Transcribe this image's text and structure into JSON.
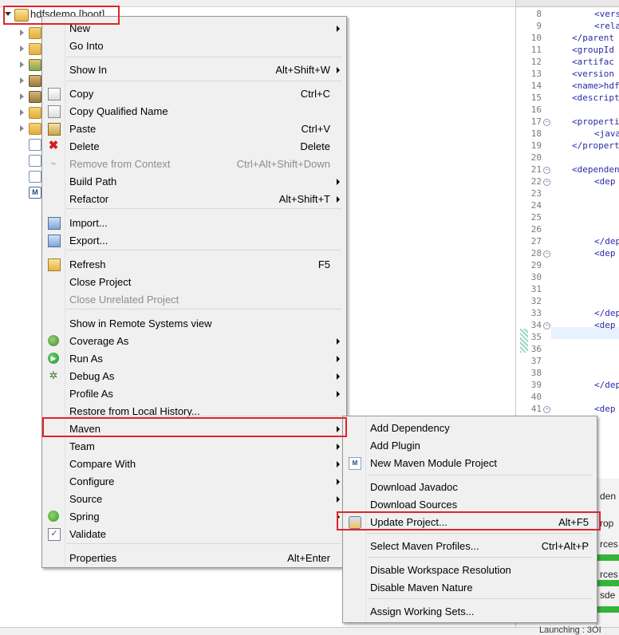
{
  "explorer": {
    "root_label": "hdfsdemo [boot]",
    "tree_icons": [
      "folder-icon",
      "folder-icon",
      "jar-icon",
      "library-icon",
      "library-icon",
      "folder-icon",
      "folder-icon",
      "file-icon",
      "file-icon",
      "file-icon",
      "maven-file-icon"
    ]
  },
  "editor": {
    "line_numbers": [
      "8",
      "9",
      "10",
      "11",
      "12",
      "13",
      "14",
      "15",
      "16",
      "17",
      "18",
      "19",
      "20",
      "21",
      "22",
      "23",
      "24",
      "25",
      "26",
      "27",
      "28",
      "29",
      "30",
      "31",
      "32",
      "33",
      "34",
      "35",
      "36",
      "37",
      "38",
      "39",
      "40",
      "41"
    ],
    "code_lines": [
      "<vers",
      "<rela",
      "</parent",
      "<groupId",
      "<artifac",
      "<version",
      "<name>hdf",
      "<descript",
      "",
      "<properti",
      "<java",
      "</propert",
      "",
      "<dependen",
      "<dep",
      "",
      "",
      "",
      "",
      "</dep",
      "<dep",
      "",
      "",
      "",
      "",
      "</dep",
      "<dep",
      "",
      "",
      "",
      "",
      "</dep",
      "",
      "<dep"
    ],
    "console_texts": [
      "den",
      "rop",
      "rces",
      "rces",
      "sde"
    ],
    "status_text": "Launching : 3OI"
  },
  "context_menu": {
    "items": [
      {
        "label": "New",
        "shortcut": "",
        "submenu": true,
        "icon": "",
        "disabled": false
      },
      {
        "label": "Go Into",
        "shortcut": "",
        "submenu": false,
        "icon": "",
        "disabled": false
      },
      {
        "label": "Show In",
        "shortcut": "Alt+Shift+W",
        "submenu": true,
        "icon": "",
        "disabled": false
      },
      {
        "label": "Copy",
        "shortcut": "Ctrl+C",
        "submenu": false,
        "icon": "copy-icon",
        "disabled": false
      },
      {
        "label": "Copy Qualified Name",
        "shortcut": "",
        "submenu": false,
        "icon": "copy-qualified-icon",
        "disabled": false
      },
      {
        "label": "Paste",
        "shortcut": "Ctrl+V",
        "submenu": false,
        "icon": "paste-icon",
        "disabled": false
      },
      {
        "label": "Delete",
        "shortcut": "Delete",
        "submenu": false,
        "icon": "delete-icon",
        "disabled": false
      },
      {
        "label": "Remove from Context",
        "shortcut": "Ctrl+Alt+Shift+Down",
        "submenu": false,
        "icon": "remove-context-icon",
        "disabled": true
      },
      {
        "label": "Build Path",
        "shortcut": "",
        "submenu": true,
        "icon": "",
        "disabled": false
      },
      {
        "label": "Refactor",
        "shortcut": "Alt+Shift+T",
        "submenu": true,
        "icon": "",
        "disabled": false
      },
      {
        "label": "Import...",
        "shortcut": "",
        "submenu": false,
        "icon": "import-icon",
        "disabled": false
      },
      {
        "label": "Export...",
        "shortcut": "",
        "submenu": false,
        "icon": "export-icon",
        "disabled": false
      },
      {
        "label": "Refresh",
        "shortcut": "F5",
        "submenu": false,
        "icon": "refresh-icon",
        "disabled": false
      },
      {
        "label": "Close Project",
        "shortcut": "",
        "submenu": false,
        "icon": "",
        "disabled": false
      },
      {
        "label": "Close Unrelated Project",
        "shortcut": "",
        "submenu": false,
        "icon": "",
        "disabled": true
      },
      {
        "label": "Show in Remote Systems view",
        "shortcut": "",
        "submenu": false,
        "icon": "",
        "disabled": false
      },
      {
        "label": "Coverage As",
        "shortcut": "",
        "submenu": true,
        "icon": "coverage-icon",
        "disabled": false
      },
      {
        "label": "Run As",
        "shortcut": "",
        "submenu": true,
        "icon": "run-icon",
        "disabled": false
      },
      {
        "label": "Debug As",
        "shortcut": "",
        "submenu": true,
        "icon": "debug-icon",
        "disabled": false
      },
      {
        "label": "Profile As",
        "shortcut": "",
        "submenu": true,
        "icon": "",
        "disabled": false
      },
      {
        "label": "Restore from Local History...",
        "shortcut": "",
        "submenu": false,
        "icon": "",
        "disabled": false
      },
      {
        "label": "Maven",
        "shortcut": "",
        "submenu": true,
        "icon": "",
        "disabled": false
      },
      {
        "label": "Team",
        "shortcut": "",
        "submenu": true,
        "icon": "",
        "disabled": false
      },
      {
        "label": "Compare With",
        "shortcut": "",
        "submenu": true,
        "icon": "",
        "disabled": false
      },
      {
        "label": "Configure",
        "shortcut": "",
        "submenu": true,
        "icon": "",
        "disabled": false
      },
      {
        "label": "Source",
        "shortcut": "",
        "submenu": true,
        "icon": "",
        "disabled": false
      },
      {
        "label": "Spring",
        "shortcut": "",
        "submenu": true,
        "icon": "spring-icon",
        "disabled": false
      },
      {
        "label": "Validate",
        "shortcut": "",
        "submenu": false,
        "icon": "validate-icon",
        "disabled": false
      },
      {
        "label": "Properties",
        "shortcut": "Alt+Enter",
        "submenu": false,
        "icon": "",
        "disabled": false
      }
    ]
  },
  "maven_menu": {
    "items": [
      {
        "label": "Add Dependency",
        "shortcut": "",
        "icon": ""
      },
      {
        "label": "Add Plugin",
        "shortcut": "",
        "icon": ""
      },
      {
        "label": "New Maven Module Project",
        "shortcut": "",
        "icon": "maven-module-icon"
      },
      {
        "label": "Download Javadoc",
        "shortcut": "",
        "icon": ""
      },
      {
        "label": "Download Sources",
        "shortcut": "",
        "icon": ""
      },
      {
        "label": "Update Project...",
        "shortcut": "Alt+F5",
        "icon": "update-project-icon"
      },
      {
        "label": "Select Maven Profiles...",
        "shortcut": "Ctrl+Alt+P",
        "icon": ""
      },
      {
        "label": "Disable Workspace Resolution",
        "shortcut": "",
        "icon": ""
      },
      {
        "label": "Disable Maven Nature",
        "shortcut": "",
        "icon": ""
      },
      {
        "label": "Assign Working Sets...",
        "shortcut": "",
        "icon": ""
      }
    ]
  },
  "highlight_color": "#e0242c"
}
